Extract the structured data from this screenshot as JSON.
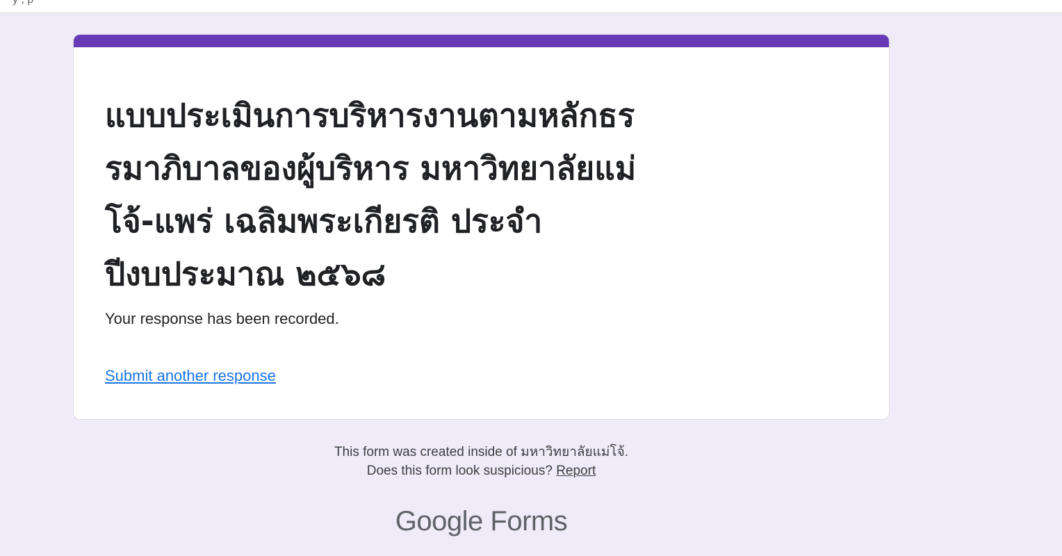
{
  "topbar": {
    "partial_text": "y                                    ,                p"
  },
  "card": {
    "accent_color": "#673ab7",
    "title": "แบบประเมินการบริหารงานตามหลักธร\nรมาภิบาลของผู้บริหาร มหาวิทยาลัยแม่\nโจ้-แพร่ เฉลิมพระเกียรติ ประจำ\nปีงบประมาณ  ๒๕๖๘",
    "confirmation": "Your response has been recorded.",
    "submit_another_label": "Submit another response"
  },
  "footer": {
    "created_inside": "This form was created inside of มหาวิทยาลัยแม่โจ้.",
    "suspicious_question": "Does this form look suspicious?",
    "report_label": "Report"
  },
  "brand": {
    "google": "Google",
    "forms": "Forms"
  }
}
